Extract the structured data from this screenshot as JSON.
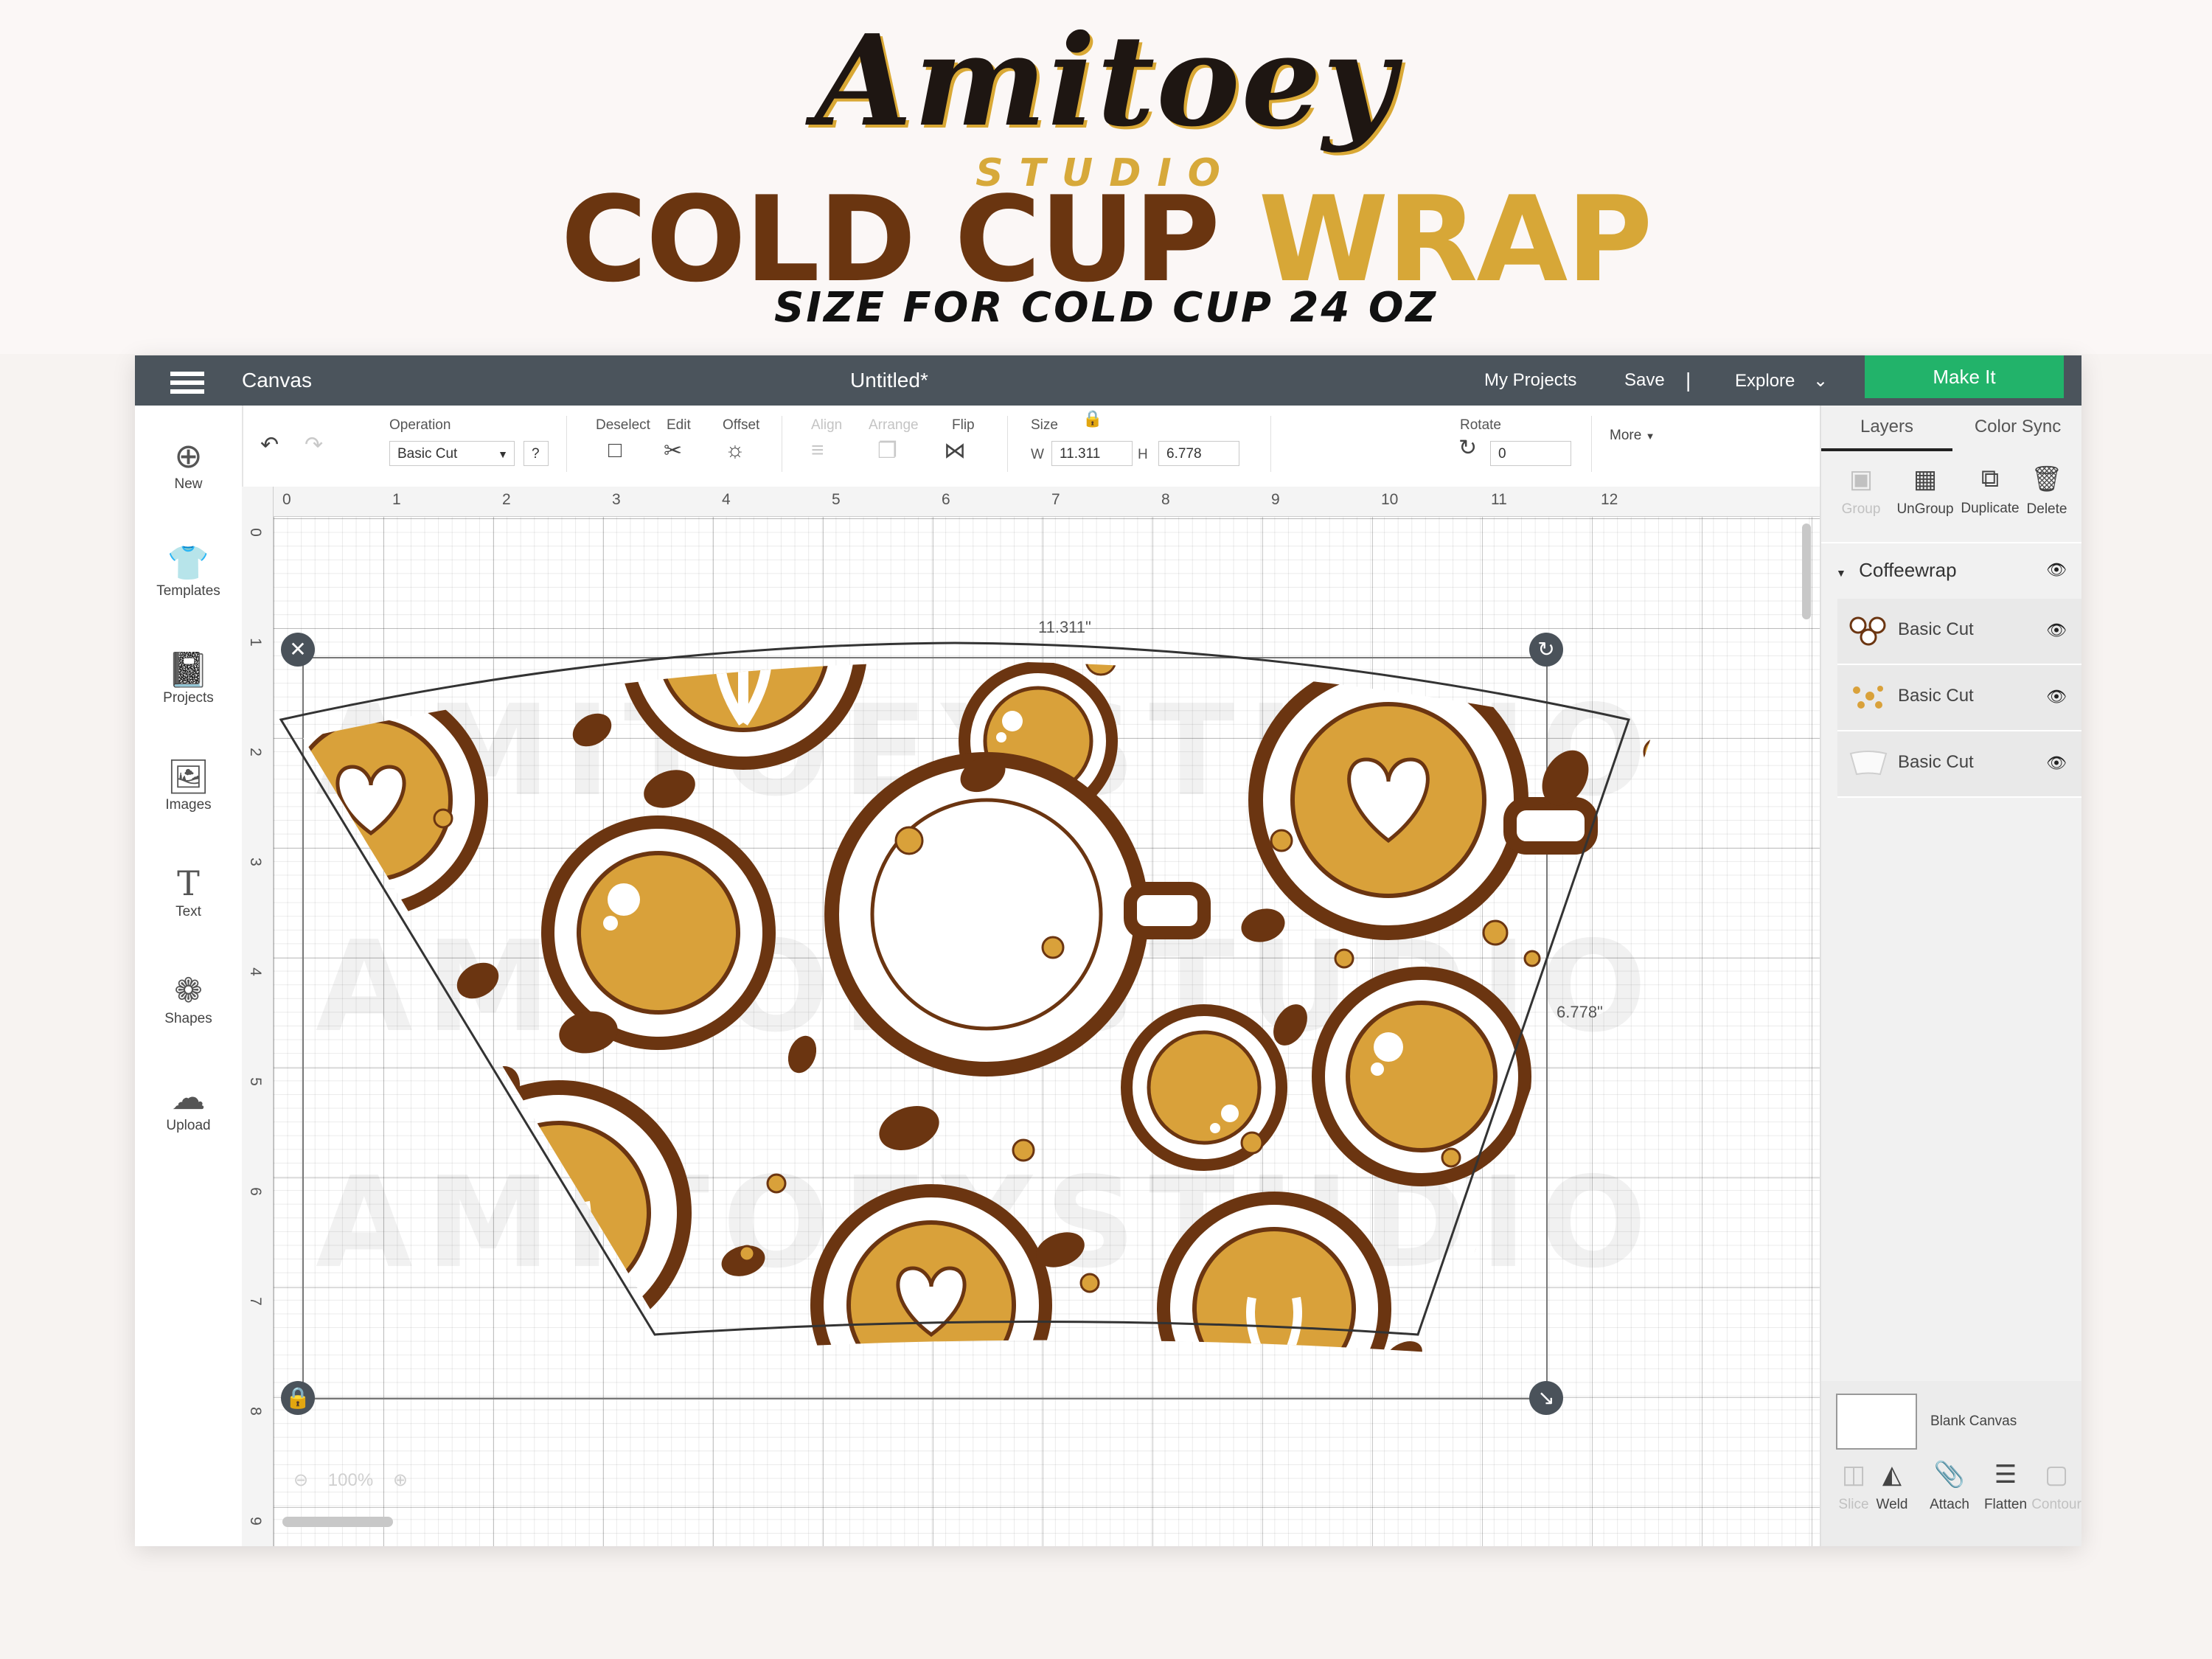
{
  "banner": {
    "brand": "Amitoey",
    "studio": "STUDIO",
    "headline_part1": "COLD CUP",
    "headline_part2": "WRAP",
    "subline": "SIZE FOR COLD CUP 24 OZ"
  },
  "topbar": {
    "app_name": "Canvas",
    "doc_title": "Untitled*",
    "my_projects": "My Projects",
    "save": "Save",
    "divider": "|",
    "explore": "Explore",
    "make_it": "Make It"
  },
  "toolbar": {
    "operation_label": "Operation",
    "operation_value": "Basic Cut",
    "help": "?",
    "deselect": "Deselect",
    "edit": "Edit",
    "offset": "Offset",
    "align": "Align",
    "arrange": "Arrange",
    "flip": "Flip",
    "size_label": "Size",
    "w_label": "W",
    "w_value": "11.311",
    "h_label": "H",
    "h_value": "6.778",
    "rotate_label": "Rotate",
    "rotate_value": "0",
    "more": "More"
  },
  "sidebar": {
    "items": [
      {
        "label": "New",
        "icon": "plus-circle-icon"
      },
      {
        "label": "Templates",
        "icon": "tshirt-icon"
      },
      {
        "label": "Projects",
        "icon": "notebook-icon"
      },
      {
        "label": "Images",
        "icon": "image-icon"
      },
      {
        "label": "Text",
        "icon": "text-icon"
      },
      {
        "label": "Shapes",
        "icon": "shapes-icon"
      },
      {
        "label": "Upload",
        "icon": "cloud-upload-icon"
      }
    ]
  },
  "panel": {
    "tabs": [
      "Layers",
      "Color Sync"
    ],
    "actions": [
      "Group",
      "UnGroup",
      "Duplicate",
      "Delete"
    ],
    "group_name": "Coffeewrap",
    "layers": [
      "Basic Cut",
      "Basic Cut",
      "Basic Cut"
    ],
    "blank_canvas": "Blank Canvas",
    "bottom_actions": [
      "Slice",
      "Weld",
      "Attach",
      "Flatten",
      "Contour"
    ]
  },
  "canvas": {
    "ruler_h": [
      "0",
      "1",
      "2",
      "3",
      "4",
      "5",
      "6",
      "7",
      "8",
      "9",
      "10",
      "11",
      "12"
    ],
    "ruler_v": [
      "0",
      "1",
      "2",
      "3",
      "4",
      "5",
      "6",
      "7",
      "8",
      "9"
    ],
    "width_readout": "11.311\"",
    "height_readout": "6.778\"",
    "zoom": "100%",
    "watermark": "AMITOEYSTUDIO"
  },
  "colors": {
    "brown": "#6b3511",
    "gold": "#d9a13a",
    "topbar": "#4b545c",
    "make_it": "#22b36a"
  }
}
